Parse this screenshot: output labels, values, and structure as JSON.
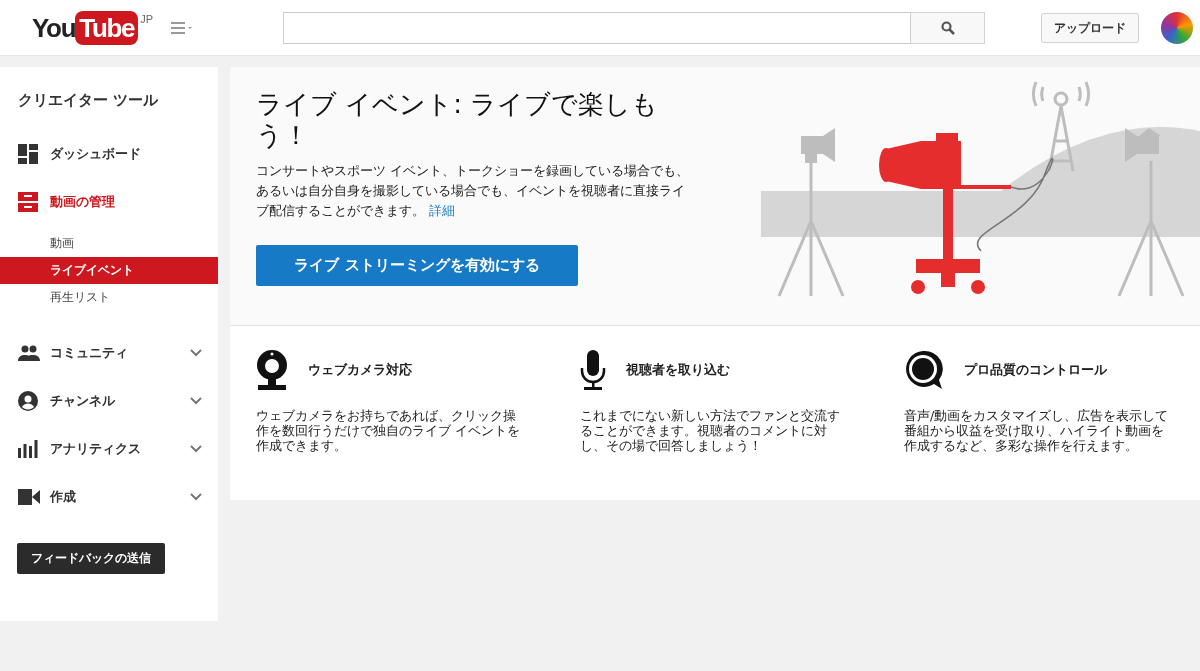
{
  "header": {
    "logo": {
      "you": "You",
      "tube": "Tube",
      "region": "JP"
    },
    "upload_button": "アップロード"
  },
  "sidebar": {
    "title": "クリエイター ツール",
    "items": [
      {
        "kind": "dashboard",
        "label": "ダッシュボード",
        "selected": false,
        "collapsible": false
      },
      {
        "kind": "manager",
        "label": "動画の管理",
        "selected": true,
        "collapsible": false,
        "children": [
          {
            "label": "動画",
            "selected": false
          },
          {
            "label": "ライブイベント",
            "selected": true
          },
          {
            "label": "再生リスト",
            "selected": false
          }
        ]
      },
      {
        "kind": "community",
        "label": "コミュニティ",
        "selected": false,
        "collapsible": true
      },
      {
        "kind": "channel",
        "label": "チャンネル",
        "selected": false,
        "collapsible": true
      },
      {
        "kind": "analytics",
        "label": "アナリティクス",
        "selected": false,
        "collapsible": true
      },
      {
        "kind": "create",
        "label": "作成",
        "selected": false,
        "collapsible": true
      }
    ],
    "feedback_button": "フィードバックの送信"
  },
  "hero": {
    "title": "ライブ イベント: ライブで楽しもう！",
    "description": "コンサートやスポーツ イベント、トークショーを録画している場合でも、あるいは自分自身を撮影している場合でも、イベントを視聴者に直接ライブ配信することができます。",
    "link": "詳細",
    "button": "ライブ ストリーミングを有効にする"
  },
  "features": [
    {
      "kind": "webcam",
      "title": "ウェブカメラ対応",
      "text": "ウェブカメラをお持ちであれば、クリック操作を数回行うだけで独自のライブ イベントを作成できます。"
    },
    {
      "kind": "microphone",
      "title": "視聴者を取り込む",
      "text": "これまでにない新しい方法でファンと交流することができます。視聴者のコメントに対し、その場で回答しましょう！"
    },
    {
      "kind": "chat",
      "title": "プロ品質のコントロール",
      "text": "音声/動画をカスタマイズし、広告を表示して番組から収益を受け取り、ハイライト動画を作成するなど、多彩な操作を行えます。"
    }
  ]
}
